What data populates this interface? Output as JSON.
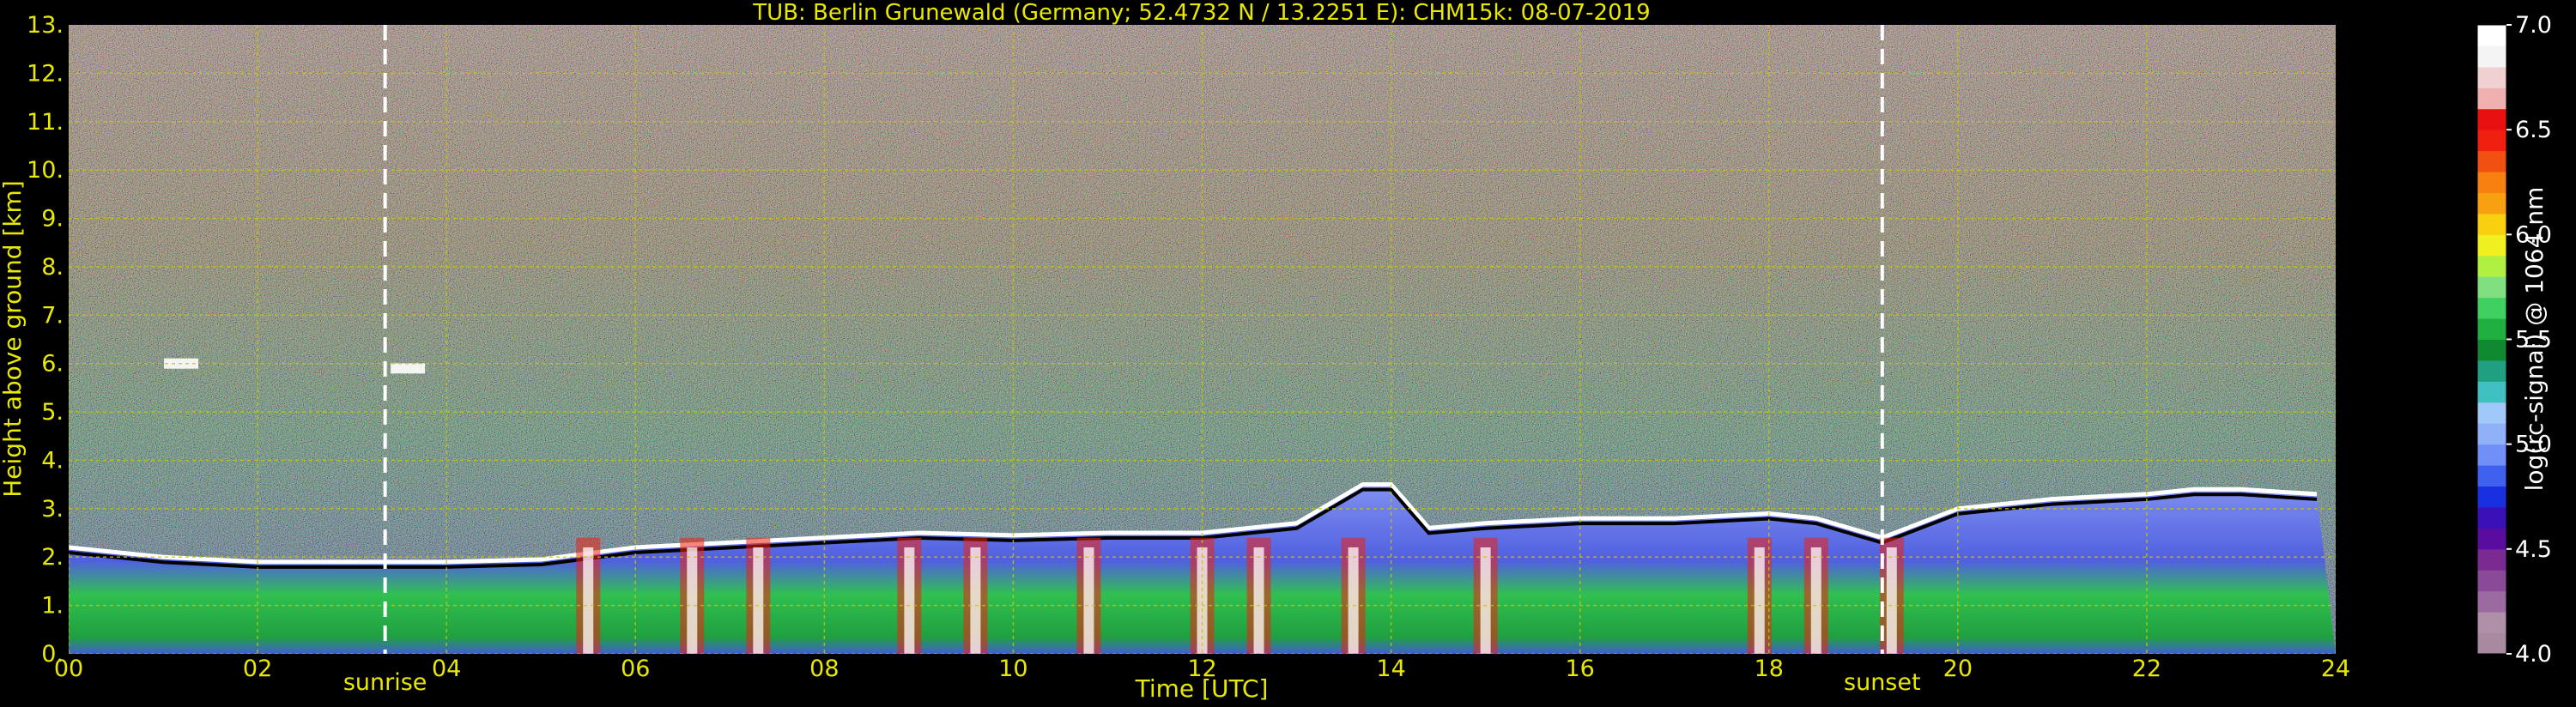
{
  "chart_data": {
    "type": "heatmap",
    "title": "TUB: Berlin Grunewald (Germany; 52.4732 N / 13.2251 E):    CHM15k: 08-07-2019",
    "xlabel": "Time [UTC]",
    "ylabel": "Height above ground [km]",
    "xlim": [
      0,
      24
    ],
    "ylim": [
      0,
      13
    ],
    "x_ticks": [
      "00",
      "02",
      "04",
      "06",
      "08",
      "10",
      "12",
      "14",
      "16",
      "18",
      "20",
      "22",
      "24"
    ],
    "y_ticks": [
      "0.",
      "1.",
      "2.",
      "3.",
      "4.",
      "5.",
      "6.",
      "7.",
      "8.",
      "9.",
      "10.",
      "11.",
      "12.",
      "13."
    ],
    "grid": true,
    "annotations": [
      {
        "label": "sunrise",
        "x": 3.35
      },
      {
        "label": "sunset",
        "x": 19.2
      }
    ],
    "colorbar": {
      "label": "log(rc-signal) @ 1064 nm",
      "range": [
        4.0,
        7.0
      ],
      "ticks": [
        "4.0",
        "4.5",
        "5.0",
        "5.5",
        "6.0",
        "6.5",
        "7.0"
      ],
      "colors": [
        "#a88aa0",
        "#b08fa8",
        "#9a6aa0",
        "#8a4a98",
        "#7a2a90",
        "#5a0ca0",
        "#3a10b8",
        "#1830e0",
        "#4060f0",
        "#7090f8",
        "#90b0f8",
        "#a0c8f8",
        "#40c0c0",
        "#20a080",
        "#108a30",
        "#20b040",
        "#40d060",
        "#80e080",
        "#b0f040",
        "#f0f020",
        "#f8d010",
        "#f8a010",
        "#f88010",
        "#f05010",
        "#f02010",
        "#e81010",
        "#f0b0b0",
        "#f0d0d0",
        "#f4f4f4",
        "#ffffff"
      ]
    },
    "layers": {
      "boundary_layer_top_km": [
        [
          0,
          2.2
        ],
        [
          1,
          2.0
        ],
        [
          2,
          1.9
        ],
        [
          3,
          1.9
        ],
        [
          4,
          1.9
        ],
        [
          5,
          1.95
        ],
        [
          6,
          2.2
        ],
        [
          7,
          2.3
        ],
        [
          8,
          2.4
        ],
        [
          9,
          2.5
        ],
        [
          10,
          2.45
        ],
        [
          11,
          2.5
        ],
        [
          12,
          2.5
        ],
        [
          13,
          2.7
        ],
        [
          13.7,
          3.5
        ],
        [
          14,
          3.5
        ],
        [
          14.4,
          2.6
        ],
        [
          15,
          2.7
        ],
        [
          16,
          2.8
        ],
        [
          17,
          2.8
        ],
        [
          18,
          2.9
        ],
        [
          18.5,
          2.8
        ],
        [
          19.2,
          2.4
        ],
        [
          20,
          3.0
        ],
        [
          21,
          3.2
        ],
        [
          22,
          3.3
        ],
        [
          22.5,
          3.4
        ],
        [
          23,
          3.4
        ],
        [
          23.8,
          3.3
        ]
      ],
      "plumes_x": [
        5.5,
        6.6,
        7.3,
        8.9,
        9.6,
        10.8,
        12.0,
        12.6,
        13.6,
        15.0,
        17.9,
        18.5,
        19.3
      ],
      "residual_cloud_km": [
        [
          3.5,
          5.9
        ],
        [
          1.1,
          6.0
        ]
      ]
    }
  }
}
